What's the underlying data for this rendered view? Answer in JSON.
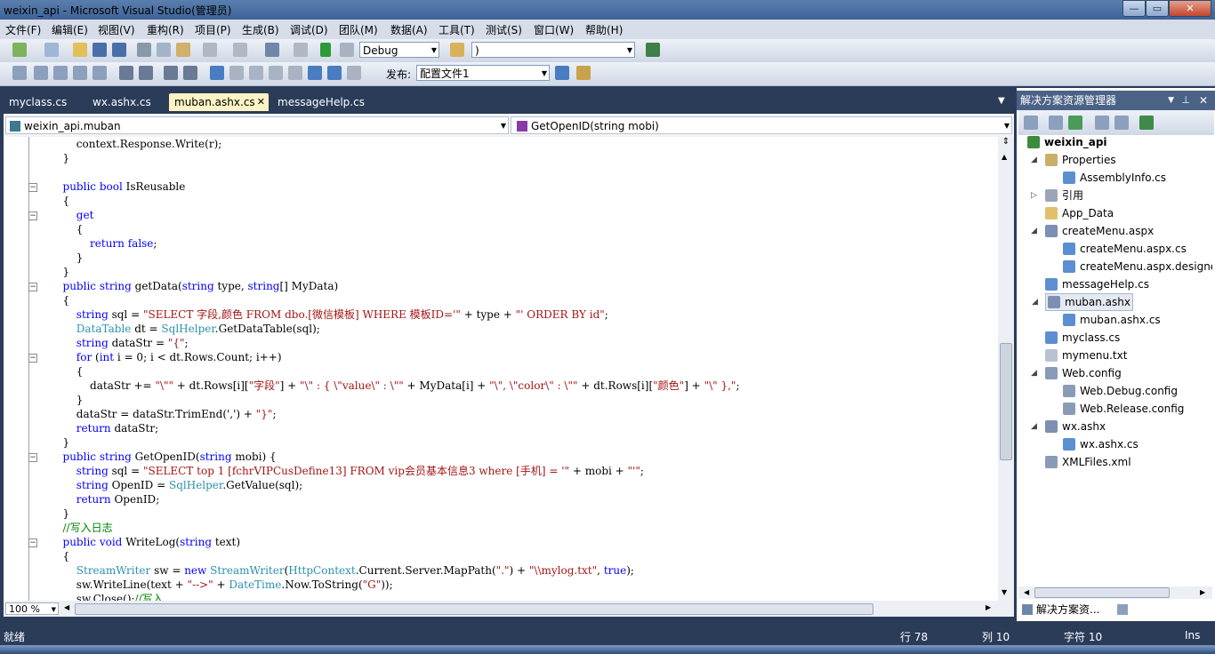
{
  "window": {
    "title": "weixin_api - Microsoft Visual Studio(管理员)",
    "min": "—",
    "max": "▭",
    "close": "✕"
  },
  "menu": [
    "文件(F)",
    "编辑(E)",
    "视图(V)",
    "重构(R)",
    "项目(P)",
    "生成(B)",
    "调试(D)",
    "团队(M)",
    "数据(A)",
    "工具(T)",
    "测试(S)",
    "窗口(W)",
    "帮助(H)"
  ],
  "toolbar1": {
    "config_value": "Debug",
    "search_value": ")"
  },
  "toolbar2": {
    "publish_label": "发布:",
    "publish_value": "配置文件1"
  },
  "tabs": [
    "myclass.cs",
    "wx.ashx.cs",
    "muban.ashx.cs",
    "messageHelp.cs"
  ],
  "tab_close": "✕",
  "nav": {
    "class_combo": "weixin_api.muban",
    "member_combo": "GetOpenID(string mobi)"
  },
  "editor": {
    "zoom": "100 %"
  },
  "code_lines": [
    "            context.Response.Write(r);",
    "        }",
    "",
    "        public bool IsReusable",
    "        {",
    "            get",
    "            {",
    "                return false;",
    "            }",
    "        }",
    "        public string getData(string type, string[] MyData)",
    "        {",
    "            string sql = \"SELECT 字段,颜色 FROM dbo.[微信模板] WHERE 模板ID='\" + type + \"' ORDER BY id\";",
    "            DataTable dt = SqlHelper.GetDataTable(sql);",
    "            string dataStr = \"{\";",
    "            for (int i = 0; i < dt.Rows.Count; i++)",
    "            {",
    "                dataStr += \"\\\"\" + dt.Rows[i][\"字段\"] + \"\\\" : { \\\"value\\\" : \\\"\" + MyData[i] + \"\\\", \\\"color\\\" : \\\"\" + dt.Rows[i][\"颜色\"] + \"\\\" },\";",
    "            }",
    "            dataStr = dataStr.TrimEnd(',') + \"}\";",
    "            return dataStr;",
    "        }",
    "        public string GetOpenID(string mobi) {",
    "            string sql = \"SELECT top 1 [fchrVIPCusDefine13] FROM vip会员基本信息3 where [手机] = '\" + mobi + \"'\";",
    "            string OpenID = SqlHelper.GetValue(sql);",
    "            return OpenID;",
    "        }",
    "        //写入日志",
    "        public void WriteLog(string text)",
    "        {",
    "            StreamWriter sw = new StreamWriter(HttpContext.Current.Server.MapPath(\".\") + \"\\\\mylog.txt\", true);",
    "            sw.WriteLine(text + \"-->\" + DateTime.Now.ToString(\"G\"));",
    "            sw.Close();//写入"
  ],
  "solution_explorer": {
    "title": "解决方案资源管理器",
    "items": [
      {
        "label": "weixin_api",
        "icon": "project-icon",
        "color": "#3d8b3d"
      },
      {
        "label": "Properties",
        "icon": "folder-icon",
        "color": "#c9b06a"
      },
      {
        "label": "AssemblyInfo.cs",
        "icon": "csharp-file-icon",
        "color": "#5b8fd1"
      },
      {
        "label": "引用",
        "icon": "references-icon",
        "color": "#9aa6b8"
      },
      {
        "label": "App_Data",
        "icon": "folder-icon",
        "color": "#e2c06a"
      },
      {
        "label": "createMenu.aspx",
        "icon": "aspx-file-icon",
        "color": "#7d8fb3"
      },
      {
        "label": "createMenu.aspx.cs",
        "icon": "csharp-file-icon",
        "color": "#5b8fd1"
      },
      {
        "label": "createMenu.aspx.designer.cs",
        "icon": "csharp-file-icon",
        "color": "#5b8fd1"
      },
      {
        "label": "messageHelp.cs",
        "icon": "csharp-file-icon",
        "color": "#5b8fd1"
      },
      {
        "label": "muban.ashx",
        "icon": "ashx-file-icon",
        "color": "#7d8fb3"
      },
      {
        "label": "muban.ashx.cs",
        "icon": "csharp-file-icon",
        "color": "#5b8fd1"
      },
      {
        "label": "myclass.cs",
        "icon": "csharp-file-icon",
        "color": "#5b8fd1"
      },
      {
        "label": "mymenu.txt",
        "icon": "text-file-icon",
        "color": "#b8c2d2"
      },
      {
        "label": "Web.config",
        "icon": "config-file-icon",
        "color": "#8a9bb8"
      },
      {
        "label": "Web.Debug.config",
        "icon": "config-file-icon",
        "color": "#8a9bb8"
      },
      {
        "label": "Web.Release.config",
        "icon": "config-file-icon",
        "color": "#8a9bb8"
      },
      {
        "label": "wx.ashx",
        "icon": "ashx-file-icon",
        "color": "#7d8fb3"
      },
      {
        "label": "wx.ashx.cs",
        "icon": "csharp-file-icon",
        "color": "#5b8fd1"
      },
      {
        "label": "XMLFiles.xml",
        "icon": "xml-file-icon",
        "color": "#8a9bb8"
      }
    ],
    "bottom_tabs": [
      "解决方案资...",
      "服务器资源..."
    ]
  },
  "status": {
    "ready": "就绪",
    "line": "行 78",
    "col": "列 10",
    "char": "字符 10",
    "mode": "Ins"
  }
}
